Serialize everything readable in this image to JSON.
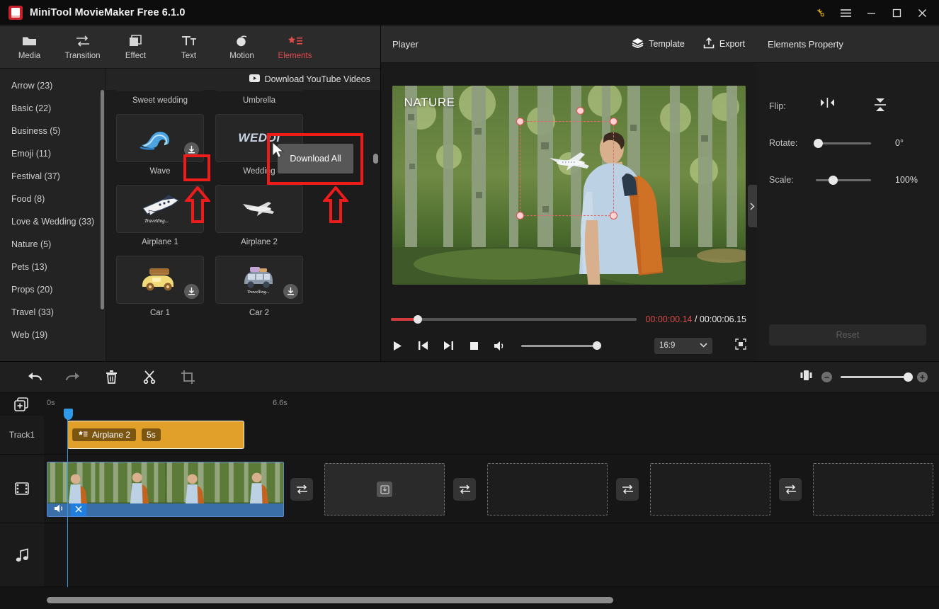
{
  "window": {
    "title": "MiniTool MovieMaker Free 6.1.0",
    "controls": {
      "key": "key-icon",
      "menu": "hamburger-menu-icon",
      "minimize": "—",
      "maximize": "▢",
      "close": "✕"
    }
  },
  "ribbon": {
    "items": [
      {
        "label": "Media",
        "icon": "folder-icon",
        "active": false
      },
      {
        "label": "Transition",
        "icon": "transition-icon",
        "active": false
      },
      {
        "label": "Effect",
        "icon": "effect-icon",
        "active": false
      },
      {
        "label": "Text",
        "icon": "text-icon",
        "active": false
      },
      {
        "label": "Motion",
        "icon": "motion-icon",
        "active": false
      },
      {
        "label": "Elements",
        "icon": "elements-icon",
        "active": true
      }
    ],
    "active_color": "#e14b4b"
  },
  "library": {
    "categories": [
      {
        "label": "Arrow (23)"
      },
      {
        "label": "Basic (22)"
      },
      {
        "label": "Business (5)"
      },
      {
        "label": "Emoji (11)"
      },
      {
        "label": "Festival (37)"
      },
      {
        "label": "Food (8)"
      },
      {
        "label": "Love & Wedding (33)"
      },
      {
        "label": "Nature (5)"
      },
      {
        "label": "Pets (13)"
      },
      {
        "label": "Props (20)"
      },
      {
        "label": "Travel (33)"
      },
      {
        "label": "Web (19)"
      }
    ],
    "youtube_button": "Download YouTube Videos",
    "rows": [
      {
        "cells": [
          {
            "label": "Sweet wedding"
          },
          {
            "label": "Umbrella"
          }
        ]
      },
      {
        "cells": [
          {
            "label": "Wave",
            "download": true
          },
          {
            "label": "Wedding",
            "download": false
          }
        ]
      },
      {
        "cells": [
          {
            "label": "Airplane 1",
            "download": false
          },
          {
            "label": "Airplane 2",
            "download": false
          }
        ]
      },
      {
        "cells": [
          {
            "label": "Car 1",
            "download": true
          },
          {
            "label": "Car 2",
            "download": true
          }
        ]
      }
    ],
    "tooltip": "Download All"
  },
  "player": {
    "title": "Player",
    "template_label": "Template",
    "export_label": "Export",
    "overlay_text": "NATURE",
    "current_time": "00:00:00.14",
    "separator": "/",
    "total_time": "00:00:06.15",
    "aspect_ratio": "16:9",
    "current_time_color": "#d94a4a"
  },
  "property": {
    "title": "Elements Property",
    "flip_label": "Flip:",
    "rotate_label": "Rotate:",
    "rotate_value": "0°",
    "scale_label": "Scale:",
    "scale_value": "100%",
    "reset_label": "Reset"
  },
  "timeline": {
    "tools": [
      {
        "name": "undo",
        "glyph": "undo-icon"
      },
      {
        "name": "redo",
        "glyph": "redo-icon"
      },
      {
        "name": "delete",
        "glyph": "trash-icon"
      },
      {
        "name": "split",
        "glyph": "scissors-icon"
      },
      {
        "name": "crop",
        "glyph": "crop-icon"
      }
    ],
    "ruler": {
      "start": "0s",
      "end": "6.6s"
    },
    "track1_label": "Track1",
    "clip": {
      "name": "Airplane 2",
      "duration": "5s"
    },
    "video_track_icon": "film-icon",
    "audio_track_icon": "music-note-icon"
  }
}
